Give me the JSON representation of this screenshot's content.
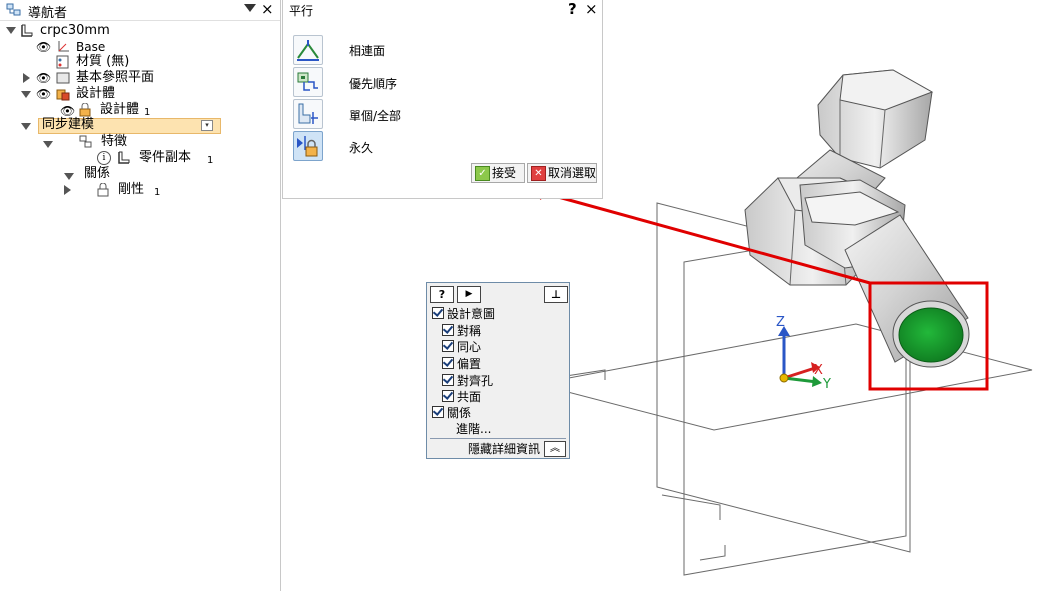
{
  "navigator": {
    "title": "導航者",
    "tree": {
      "root": "crpc30mm",
      "base": "Base",
      "material": "材質 (無)",
      "ref_planes": "基本參照平面",
      "design_bodies": "設計體",
      "design_body_item": "設計體",
      "design_body_index": "1",
      "sync_modeling": "同步建模",
      "features": "特徵",
      "part_copy": "零件副本",
      "part_copy_index": "1",
      "relations": "關係",
      "rigid": "剛性",
      "rigid_index": "1"
    }
  },
  "dialog": {
    "title": "平行",
    "help": "?",
    "close": "×",
    "options": [
      "相連面",
      "優先順序",
      "單個/全部",
      "永久"
    ],
    "accept": "接受",
    "cancel": "取消選取"
  },
  "intent_panel": {
    "help": "?",
    "play": "▶",
    "pin": "⊥",
    "title_item": "設計意圖",
    "items": [
      "對稱",
      "同心",
      "偏置",
      "對齊孔",
      "共面"
    ],
    "relations": "關係",
    "advanced": "進階...",
    "hide_details": "隱藏詳細資訊"
  },
  "axes": {
    "z": "Z",
    "x": "X",
    "y": "Y"
  },
  "colors": {
    "highlight": "#e00000",
    "face_green": "#1a9a2e",
    "selection_bg": "#fde3b0",
    "accent_blue": "#2a56c6"
  }
}
